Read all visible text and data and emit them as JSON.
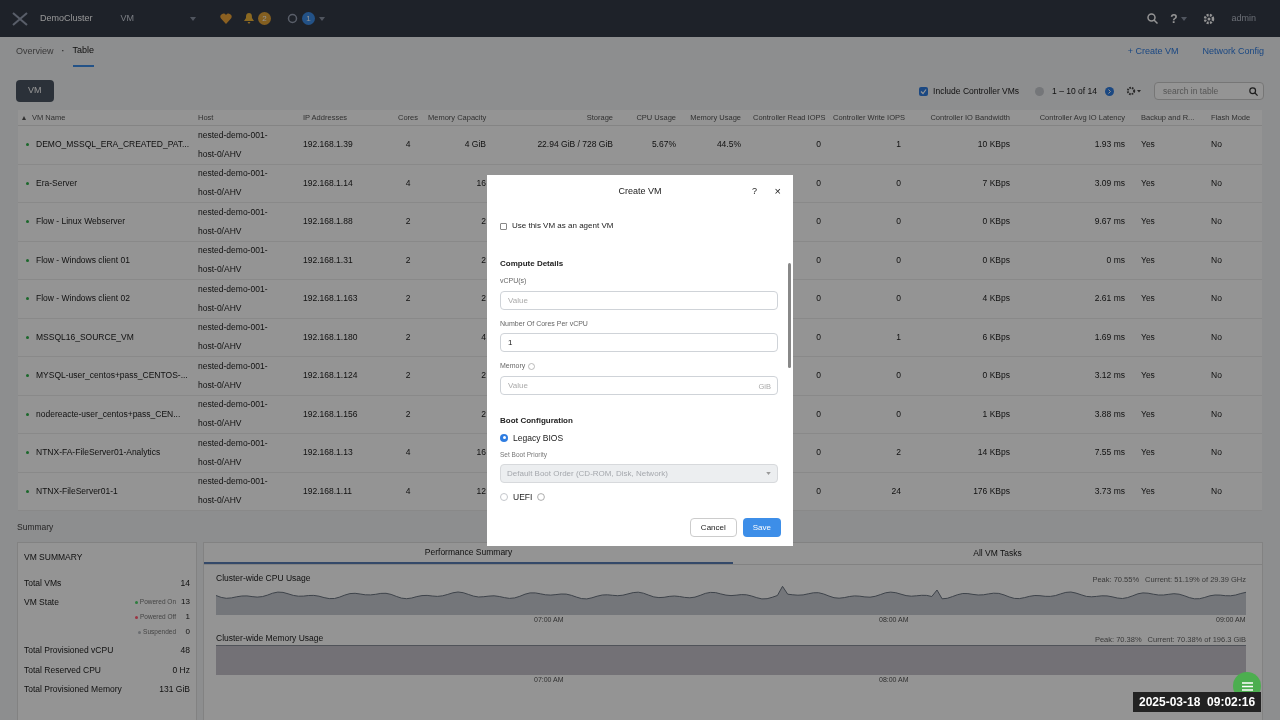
{
  "topbar": {
    "cluster": "DemoCluster",
    "view": "VM",
    "alerts_count": "2",
    "tasks_count": "1",
    "help": "?",
    "user": "admin"
  },
  "subnav": {
    "tabs": [
      {
        "label": "Overview",
        "selected": false
      },
      {
        "label": "Table",
        "selected": true
      }
    ],
    "separator": "·",
    "actions": [
      "+ Create VM",
      "Network Config"
    ]
  },
  "toolbar": {
    "view_button": "VM",
    "include_controller": {
      "label": "Include Controller VMs",
      "checked": true
    },
    "pagination": "1 – 10 of 14",
    "search": {
      "placeholder": "search in table"
    }
  },
  "table": {
    "columns": [
      "VM Name",
      "Host",
      "IP Addresses",
      "Cores",
      "Memory Capacity",
      "Storage",
      "CPU Usage",
      "Memory Usage",
      "Controller Read IOPS",
      "Controller Write IOPS",
      "Controller IO Bandwidth",
      "Controller Avg IO Latency",
      "Backup and R...",
      "Flash Mode"
    ],
    "rows": [
      {
        "cells": [
          "DEMO_MSSQL_ERA_CREATED_PAT...",
          "nested-demo-001-host-0/AHV",
          "192.168.1.39",
          "4",
          "4 GiB",
          "22.94 GiB / 728 GiB",
          "5.67%",
          "44.5%",
          "0",
          "1",
          "10 KBps",
          "1.93 ms",
          "Yes",
          "No"
        ]
      },
      {
        "cells": [
          "Era-Server",
          "nested-demo-001-host-0/AHV",
          "192.168.1.14",
          "4",
          "16",
          null,
          null,
          null,
          "0",
          "0",
          "7 KBps",
          "3.09 ms",
          "Yes",
          "No"
        ]
      },
      {
        "cells": [
          "Flow - Linux Webserver",
          "nested-demo-001-host-0/AHV",
          "192.168.1.88",
          "2",
          "2",
          null,
          null,
          null,
          "0",
          "0",
          "0 KBps",
          "9.67 ms",
          "Yes",
          "No"
        ]
      },
      {
        "cells": [
          "Flow - Windows client 01",
          "nested-demo-001-host-0/AHV",
          "192.168.1.31",
          "2",
          "2",
          null,
          null,
          null,
          "0",
          "0",
          "0 KBps",
          "0 ms",
          "Yes",
          "No"
        ]
      },
      {
        "cells": [
          "Flow - Windows client 02",
          "nested-demo-001-host-0/AHV",
          "192.168.1.163",
          "2",
          "2",
          null,
          null,
          null,
          "0",
          "0",
          "4 KBps",
          "2.61 ms",
          "Yes",
          "No"
        ]
      },
      {
        "cells": [
          "MSSQL16_SOURCE_VM",
          "nested-demo-001-host-0/AHV",
          "192.168.1.180",
          "2",
          "4",
          null,
          null,
          null,
          "0",
          "1",
          "6 KBps",
          "1.69 ms",
          "Yes",
          "No"
        ]
      },
      {
        "cells": [
          "MYSQL-user_centos+pass_CENTOS-...",
          "nested-demo-001-host-0/AHV",
          "192.168.1.124",
          "2",
          "2",
          null,
          null,
          null,
          "0",
          "0",
          "0 KBps",
          "3.12 ms",
          "Yes",
          "No"
        ]
      },
      {
        "cells": [
          "nodereacte-user_centos+pass_CEN...",
          "nested-demo-001-host-0/AHV",
          "192.168.1.156",
          "2",
          "2",
          null,
          null,
          null,
          "0",
          "0",
          "1 KBps",
          "3.88 ms",
          "Yes",
          "No"
        ]
      },
      {
        "cells": [
          "NTNX-FA-FileServer01-Analytics",
          "nested-demo-001-host-0/AHV",
          "192.168.1.13",
          "4",
          "16",
          null,
          null,
          null,
          "0",
          "2",
          "14 KBps",
          "7.55 ms",
          "Yes",
          "No"
        ]
      },
      {
        "cells": [
          "NTNX-FileServer01-1",
          "nested-demo-001-host-0/AHV",
          "192.168.1.11",
          "4",
          "12",
          null,
          null,
          null,
          "0",
          "24",
          "176 KBps",
          "3.73 ms",
          "Yes",
          "No"
        ]
      }
    ]
  },
  "summary": {
    "title": "Summary",
    "vm_summary": {
      "title": "VM SUMMARY",
      "rows": [
        {
          "kind": "plain",
          "label": "Total VMs",
          "value": "14"
        },
        {
          "kind": "states",
          "label": "VM State",
          "states": [
            {
              "label": "Powered On",
              "value": "13",
              "color": "#2e7d3e"
            },
            {
              "label": "Powered Off",
              "value": "1",
              "color": "#9c3442"
            },
            {
              "label": "Suspended",
              "value": "0",
              "color": "#6b6e72"
            }
          ]
        },
        {
          "kind": "plain",
          "label": "Total Provisioned vCPU",
          "value": "48"
        },
        {
          "kind": "plain",
          "label": "Total Reserved CPU",
          "value": "0 Hz"
        },
        {
          "kind": "plain",
          "label": "Total Provisioned Memory",
          "value": "131 GiB"
        }
      ]
    },
    "tabs": [
      {
        "label": "Performance Summary",
        "selected": true
      },
      {
        "label": "All VM Tasks",
        "selected": false
      }
    ],
    "charts": [
      {
        "kind": "wave",
        "title": "Cluster-wide CPU Usage",
        "peak": "Peak: 70.55%",
        "current": "Current: 51.19% of 29.39 GHz",
        "times": [
          "07:00 AM",
          "08:00 AM",
          "09:00 AM"
        ]
      },
      {
        "kind": "flat",
        "title": "Cluster-wide Memory Usage",
        "peak": "Peak: 70.38%",
        "current": "Current: 70.38% of 196.3 GiB",
        "times": [
          "07:00 AM",
          "08:00 AM"
        ]
      }
    ]
  },
  "dialog": {
    "title": "Create VM",
    "help": "?",
    "close": "×",
    "agent_vm": {
      "label": "Use this VM as an agent VM",
      "checked": false
    },
    "compute_title": "Compute Details",
    "fields": [
      {
        "label": "vCPU(s)",
        "info": false,
        "placeholder": "Value"
      },
      {
        "label": "Number Of Cores Per vCPU",
        "info": false,
        "value": "1"
      },
      {
        "label": "Memory",
        "info": true,
        "placeholder": "Value",
        "suffix": "GiB"
      }
    ],
    "boot_title": "Boot Configuration",
    "boot_options": [
      {
        "label": "Legacy BIOS",
        "selected": true,
        "help": false
      },
      {
        "label": "UEFI",
        "selected": false,
        "help": true
      }
    ],
    "boot_priority": {
      "label": "Set Boot Priority",
      "value": "Default Boot Order (CD-ROM, Disk, Network)",
      "disabled": true
    },
    "buttons": [
      "Cancel",
      "Save"
    ]
  },
  "timestamp": "2025-03-18  09:02:16"
}
